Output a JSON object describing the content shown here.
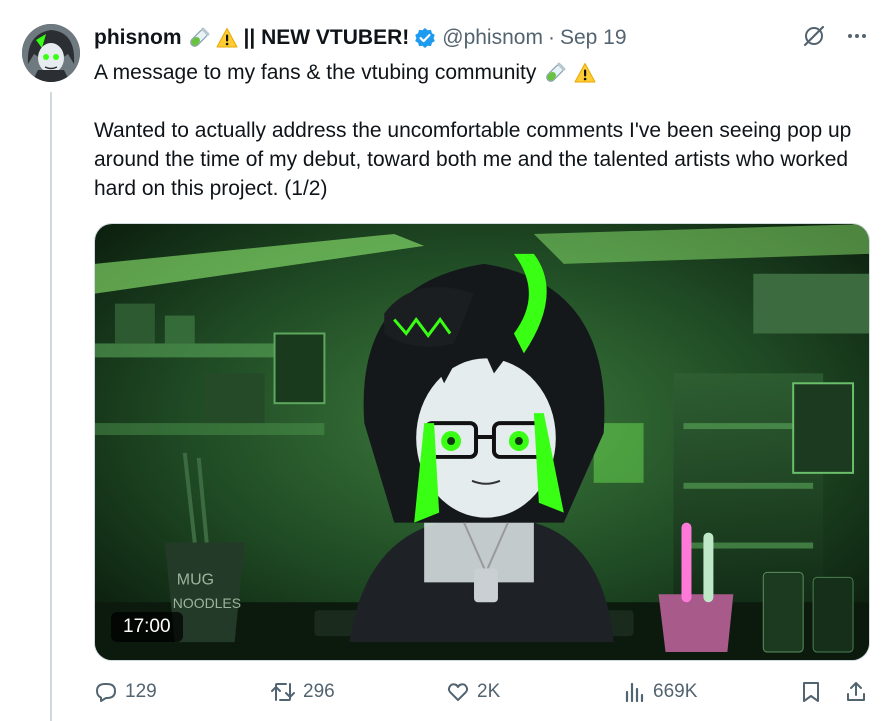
{
  "author": {
    "display_name": "phisnom",
    "name_suffix": "|| NEW VTUBER!",
    "handle": "@phisnom",
    "separator": "·",
    "date": "Sep 19",
    "emojis": [
      "test-tube",
      "warning"
    ]
  },
  "post": {
    "line1": "A message to my fans & the vtubing community",
    "line2": "Wanted to actually address the uncomfortable comments I've been seeing pop up around the time of my debut, toward both me and the talented artists who worked hard on this project. (1/2)"
  },
  "media": {
    "duration": "17:00",
    "mug_text": "MUG\nNOODLES"
  },
  "actions": {
    "replies": "129",
    "reposts": "296",
    "likes": "2K",
    "views": "669K"
  },
  "colors": {
    "accent": "#1d9bf0",
    "muted": "#536471",
    "neon": "#39ff14"
  }
}
